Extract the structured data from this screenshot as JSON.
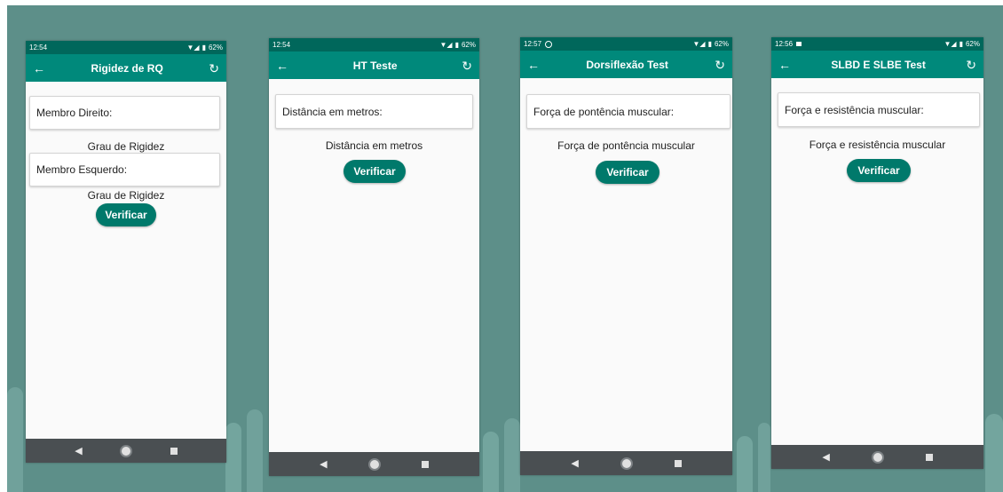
{
  "colors": {
    "status_bar": "#00675b",
    "app_bar": "#00897b",
    "button": "#00796b",
    "background": "#5d8f89",
    "nav_bar": "#4a4f52"
  },
  "screens": [
    {
      "status": {
        "time": "12:54",
        "notif_icon": "",
        "battery": "62%"
      },
      "title": "Rigidez de RQ",
      "fields": [
        {
          "label": "Membro Direito:",
          "caption": "Grau de Rigidez"
        },
        {
          "label": "Membro Esquerdo:",
          "caption": "Grau de Rigidez"
        }
      ],
      "button_label": "Verificar"
    },
    {
      "status": {
        "time": "12:54",
        "notif_icon": "",
        "battery": "62%"
      },
      "title": "HT Teste",
      "fields": [
        {
          "label": "Distância em metros:",
          "caption": "Distância em metros"
        }
      ],
      "button_label": "Verificar"
    },
    {
      "status": {
        "time": "12:57",
        "notif_icon": "whatsapp-icon",
        "battery": "62%"
      },
      "title": "Dorsiflexão Test",
      "fields": [
        {
          "label": "Força de pontência muscular:",
          "caption": "Força de pontência muscular"
        }
      ],
      "button_label": "Verificar"
    },
    {
      "status": {
        "time": "12:56",
        "notif_icon": "image-icon",
        "battery": "62%"
      },
      "title": "SLBD E SLBE Test",
      "fields": [
        {
          "label": "Força e resistência muscular:",
          "caption": "Força e resistência muscular"
        }
      ],
      "button_label": "Verificar"
    }
  ],
  "icons": {
    "back": "arrow-left-icon",
    "refresh": "refresh-icon",
    "nav": [
      "back-triangle-icon",
      "home-circle-icon",
      "recents-square-icon"
    ]
  },
  "glyphs": {
    "back": "←",
    "refresh": "↻",
    "signal": "▼◢",
    "battery": "▮",
    "nav_back": "◀"
  }
}
